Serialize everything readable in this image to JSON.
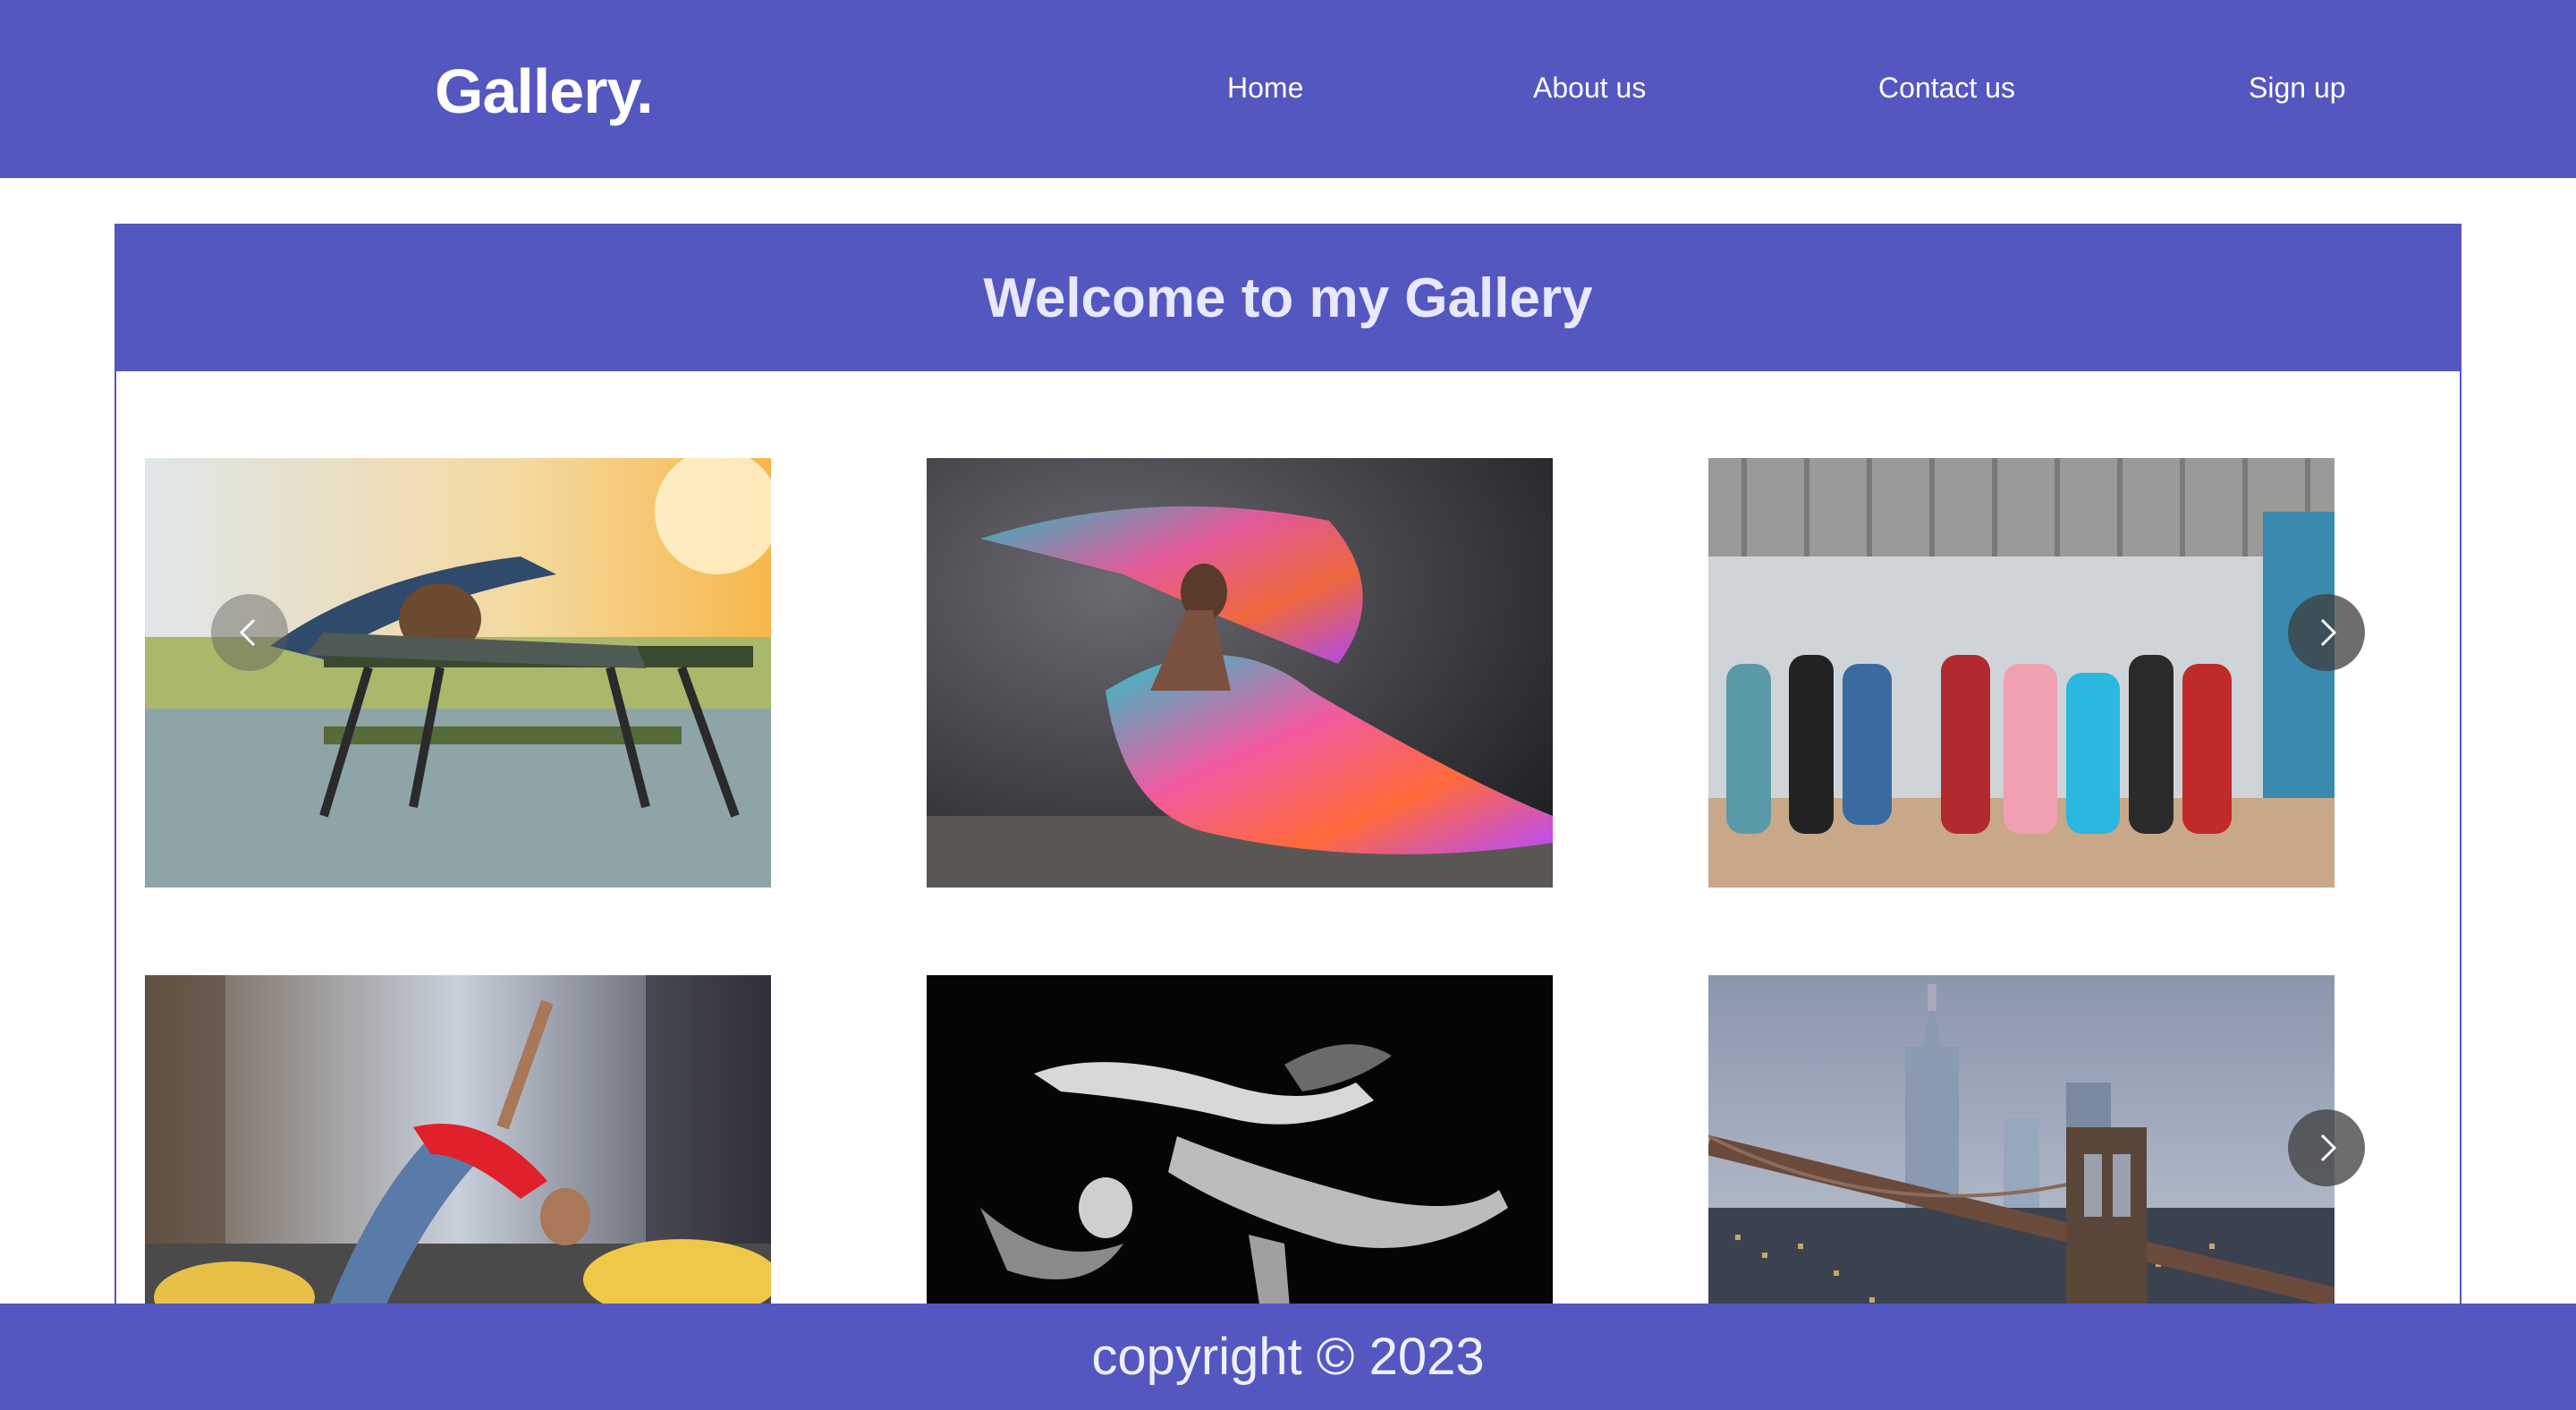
{
  "header": {
    "brand": "Gallery.",
    "nav": [
      "Home",
      "About us",
      "Contact us",
      "Sign up"
    ]
  },
  "gallery": {
    "heading": "Welcome to my Gallery",
    "rows": [
      [
        "dancer-on-picnic-table",
        "dancer-with-silk-veils",
        "dance-group-rehearsal"
      ],
      [
        "dancer-backbend-street",
        "monochrome-dancer",
        "brooklyn-bridge-skyline"
      ]
    ]
  },
  "footer": {
    "copyright": "copyright © 2023"
  },
  "colors": {
    "primary": "#5457c0",
    "text_light": "#ffffff"
  }
}
